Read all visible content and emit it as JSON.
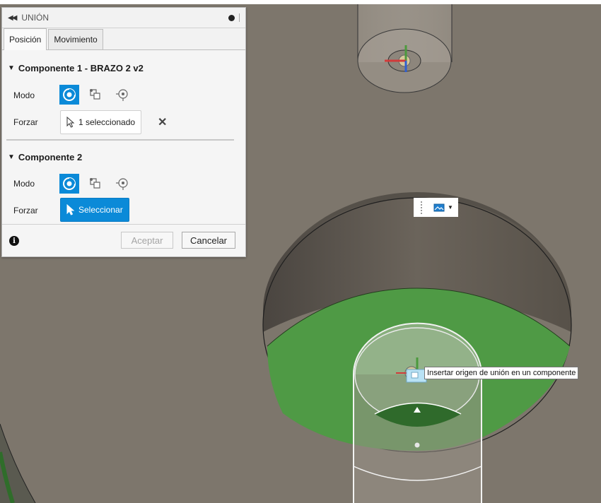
{
  "panel": {
    "title": "UNIÓN",
    "tabs": [
      {
        "label": "Posición",
        "active": true
      },
      {
        "label": "Movimiento",
        "active": false
      }
    ],
    "component1": {
      "header": "Componente 1 - BRAZO 2 v2",
      "mode_label": "Modo",
      "snap_label": "Forzar",
      "snap_value": "1 seleccionado"
    },
    "component2": {
      "header": "Componente 2",
      "mode_label": "Modo",
      "snap_label": "Forzar",
      "snap_value": "Seleccionar"
    },
    "footer": {
      "ok_label": "Aceptar",
      "cancel_label": "Cancelar",
      "ok_enabled": false
    }
  },
  "viewport": {
    "tooltip": "Insertar origen de unión en un componente",
    "colors": {
      "background": "#7d766c",
      "face_green": "#4f9a45",
      "accent_blue": "#0b8ad8"
    }
  },
  "icons": [
    "collapse-icon",
    "minimize-icon",
    "chevron-down-icon",
    "simple-mode-icon",
    "between-two-faces-icon",
    "two-edge-intersection-icon",
    "cursor-select-icon",
    "close-icon",
    "info-icon",
    "display-toggle-icon",
    "triad-icon"
  ]
}
